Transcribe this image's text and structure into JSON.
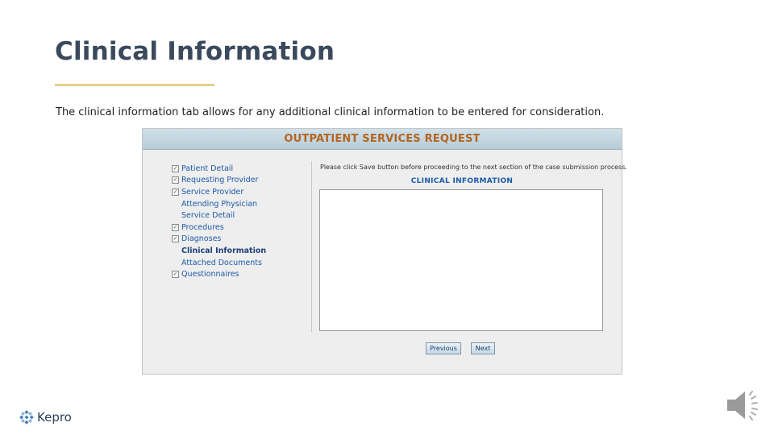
{
  "slide": {
    "title": "Clinical Information",
    "subtitle": "The clinical information tab allows for any additional clinical information to be entered for consideration.",
    "accent_color": "#e2cf8a"
  },
  "app": {
    "header_title": "OUTPATIENT SERVICES REQUEST",
    "nav_items": [
      {
        "label": "Patient Detail",
        "checked": true
      },
      {
        "label": "Requesting Provider",
        "checked": true
      },
      {
        "label": "Service Provider",
        "checked": true
      },
      {
        "label": "Attending Physician",
        "checked": false
      },
      {
        "label": "Service Detail",
        "checked": false
      },
      {
        "label": "Procedures",
        "checked": true
      },
      {
        "label": "Diagnoses",
        "checked": true
      },
      {
        "label": "Clinical Information",
        "checked": false,
        "active": true
      },
      {
        "label": "Attached Documents",
        "checked": false
      },
      {
        "label": "Questionnaires",
        "checked": true
      }
    ],
    "instruction": "Please click Save button before proceeding to the next section of the case submission process.",
    "section_title": "CLINICAL INFORMATION",
    "clinical_text": "",
    "previous_label": "Previous",
    "next_label": "Next"
  },
  "logo": {
    "text": "Kepro",
    "icon": "kepro-logo-icon",
    "color": "#4a7fb0"
  },
  "audio": {
    "icon": "speaker-icon"
  }
}
